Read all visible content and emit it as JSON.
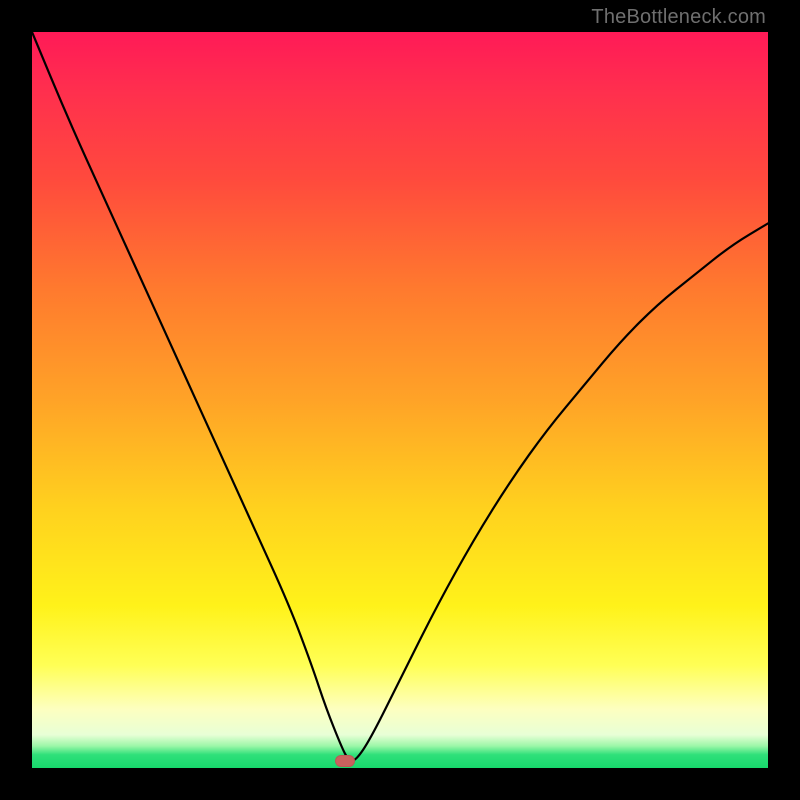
{
  "attribution": "TheBottleneck.com",
  "colors": {
    "frame_bg": "#000000",
    "marker_fill": "#c9615e",
    "curve_stroke": "#000000",
    "gradient_stops": [
      "#ff1a57",
      "#ff2f4e",
      "#ff4a3d",
      "#ff7a2e",
      "#ffa327",
      "#ffd21e",
      "#fff21a",
      "#ffff55",
      "#fdffc0",
      "#e8ffd6",
      "#9cf7a8",
      "#2fe07a",
      "#17d86c"
    ]
  },
  "chart_data": {
    "type": "line",
    "title": "",
    "xlabel": "",
    "ylabel": "",
    "xlim": [
      0,
      100
    ],
    "ylim": [
      0,
      100
    ],
    "grid": false,
    "legend": null,
    "annotations": [
      {
        "kind": "marker",
        "x": 42.5,
        "y": 1.0,
        "shape": "pill",
        "color": "#c9615e"
      }
    ],
    "series": [
      {
        "name": "bottleneck-curve",
        "x": [
          0,
          5,
          10,
          15,
          20,
          25,
          30,
          35,
          38,
          40,
          42,
          43,
          44,
          46,
          50,
          55,
          60,
          65,
          70,
          75,
          80,
          85,
          90,
          95,
          100
        ],
        "y": [
          100,
          88,
          77,
          66,
          55,
          44,
          33,
          22,
          14,
          8,
          3,
          1,
          1,
          4,
          12,
          22,
          31,
          39,
          46,
          52,
          58,
          63,
          67,
          71,
          74
        ]
      }
    ]
  }
}
